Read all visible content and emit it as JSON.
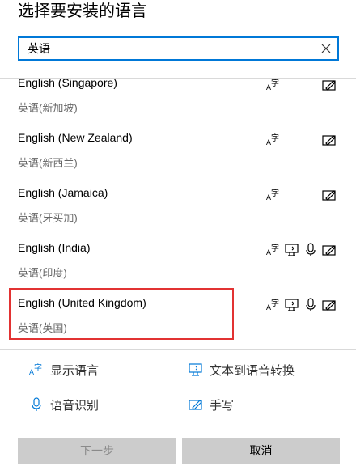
{
  "title": "选择要安装的语言",
  "search": {
    "value": "英语",
    "placeholder": ""
  },
  "languages": [
    {
      "name": "English (Singapore)",
      "native": "英语(新加坡)",
      "features": [
        "display-language",
        "handwriting"
      ]
    },
    {
      "name": "English (New Zealand)",
      "native": "英语(新西兰)",
      "features": [
        "display-language",
        "handwriting"
      ]
    },
    {
      "name": "English (Jamaica)",
      "native": "英语(牙买加)",
      "features": [
        "display-language",
        "handwriting"
      ]
    },
    {
      "name": "English (India)",
      "native": "英语(印度)",
      "features": [
        "display-language",
        "text-to-speech",
        "speech-recognition",
        "handwriting"
      ]
    },
    {
      "name": "English (United Kingdom)",
      "native": "英语(英国)",
      "features": [
        "display-language",
        "text-to-speech",
        "speech-recognition",
        "handwriting"
      ],
      "highlighted": true
    }
  ],
  "legend": {
    "display_language": "显示语言",
    "text_to_speech": "文本到语音转换",
    "speech_recognition": "语音识别",
    "handwriting": "手写"
  },
  "buttons": {
    "next": "下一步",
    "cancel": "取消"
  },
  "colors": {
    "accent": "#0078d7",
    "highlight_border": "#e23232",
    "button_bg": "#cccccc"
  }
}
